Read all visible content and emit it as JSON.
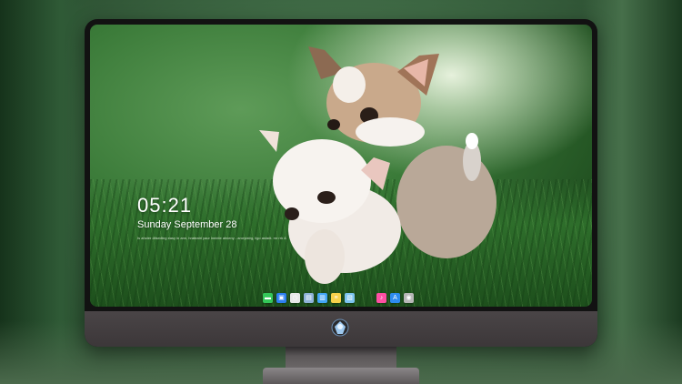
{
  "lockscreen": {
    "time": "05:21",
    "date": "Sunday September 28",
    "notice": "Is aholer dilsedtng easy in ann, hrateatrl yaur inninte alrceny - aroryiatrg, ilgo aslant. mr rrk &"
  },
  "dock": {
    "items": [
      {
        "name": "messages-icon",
        "color": "#34c759",
        "glyph": "▬"
      },
      {
        "name": "finder-icon",
        "color": "#2d7ff0",
        "glyph": "▣"
      },
      {
        "name": "clock-icon",
        "color": "#e8e8e8",
        "glyph": "◷"
      },
      {
        "name": "preview-icon",
        "color": "#8fb3d9",
        "glyph": "▤"
      },
      {
        "name": "clapper-icon",
        "color": "#42a5f5",
        "glyph": "▥"
      },
      {
        "name": "notes-icon",
        "color": "#f6d24a",
        "glyph": "≡"
      },
      {
        "name": "photos-icon",
        "color": "#7cc4f0",
        "glyph": "▧"
      },
      {
        "name": "music-icon",
        "color": "#ff4fa3",
        "glyph": "♪"
      },
      {
        "name": "app-store-icon",
        "color": "#2d8cf0",
        "glyph": "A"
      },
      {
        "name": "camera-icon",
        "color": "#b7b7b7",
        "glyph": "◉"
      }
    ],
    "separator_after_index": 6
  },
  "colors": {
    "grass_dark": "#1d4f1c",
    "grass_mid": "#3a7a38",
    "bezel": "#121212",
    "chin": "#4a4547"
  }
}
